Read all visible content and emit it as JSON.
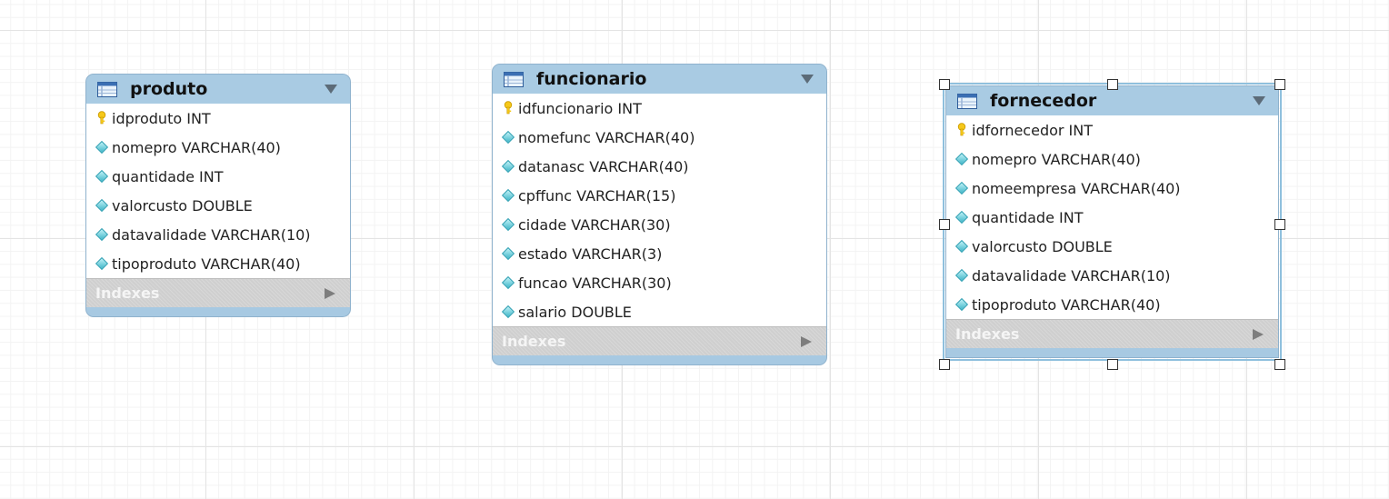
{
  "tables": [
    {
      "name": "produto",
      "columns": [
        {
          "key": true,
          "text": "idproduto INT"
        },
        {
          "key": false,
          "text": "nomepro VARCHAR(40)"
        },
        {
          "key": false,
          "text": "quantidade INT"
        },
        {
          "key": false,
          "text": "valorcusto DOUBLE"
        },
        {
          "key": false,
          "text": "datavalidade VARCHAR(10)"
        },
        {
          "key": false,
          "text": "tipoproduto VARCHAR(40)"
        }
      ],
      "indexes_label": "Indexes"
    },
    {
      "name": "funcionario",
      "columns": [
        {
          "key": true,
          "text": "idfuncionario INT"
        },
        {
          "key": false,
          "text": "nomefunc VARCHAR(40)"
        },
        {
          "key": false,
          "text": "datanasc VARCHAR(40)"
        },
        {
          "key": false,
          "text": "cpffunc VARCHAR(15)"
        },
        {
          "key": false,
          "text": "cidade VARCHAR(30)"
        },
        {
          "key": false,
          "text": "estado VARCHAR(3)"
        },
        {
          "key": false,
          "text": "funcao VARCHAR(30)"
        },
        {
          "key": false,
          "text": "salario DOUBLE"
        }
      ],
      "indexes_label": "Indexes"
    },
    {
      "name": "fornecedor",
      "selected": true,
      "columns": [
        {
          "key": true,
          "text": "idfornecedor INT"
        },
        {
          "key": false,
          "text": "nomepro VARCHAR(40)"
        },
        {
          "key": false,
          "text": "nomeempresa VARCHAR(40)"
        },
        {
          "key": false,
          "text": "quantidade INT"
        },
        {
          "key": false,
          "text": "valorcusto DOUBLE"
        },
        {
          "key": false,
          "text": "datavalidade VARCHAR(10)"
        },
        {
          "key": false,
          "text": "tipoproduto VARCHAR(40)"
        }
      ],
      "indexes_label": "Indexes"
    }
  ],
  "colors": {
    "header": "#a9cbe3",
    "key_icon": "#f2c500",
    "column_icon": "#3fb6c8",
    "indexes_bg": "#cfcfcf"
  },
  "icons": {
    "table": "table-icon",
    "primary_key": "key-icon",
    "column": "diamond-icon",
    "collapse": "triangle-down-icon",
    "expand_indexes": "triangle-right-icon"
  }
}
